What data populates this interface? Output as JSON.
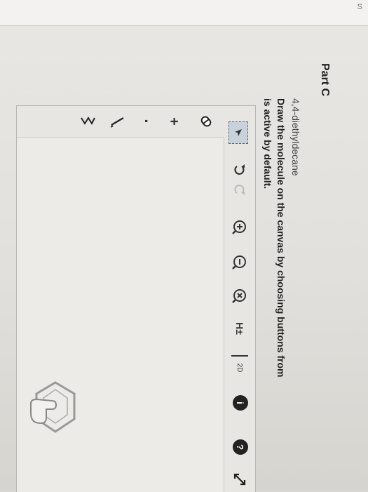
{
  "header": {
    "edge_char": "S"
  },
  "part": {
    "title": "Part C",
    "compound": "4,4-diethyldecane",
    "instruction_line1": "Draw the molecule on the canvas by choosing buttons from",
    "instruction_line2": "is active by default."
  },
  "toolbar": {
    "tools": [
      {
        "name": "select-tool",
        "icon": "marquee-select-icon"
      },
      {
        "name": "undo-button",
        "icon": "undo-icon"
      },
      {
        "name": "redo-button",
        "icon": "redo-icon"
      },
      {
        "name": "zoom-in-button",
        "icon": "zoom-in-icon"
      },
      {
        "name": "zoom-out-button",
        "icon": "zoom-out-icon"
      },
      {
        "name": "clear-button",
        "icon": "clear-icon"
      },
      {
        "name": "hydrogen-button",
        "label": "H±"
      },
      {
        "name": "2d-button",
        "label": "2D"
      },
      {
        "name": "info-button",
        "label": "i"
      },
      {
        "name": "help-button",
        "label": "?"
      },
      {
        "name": "expand-button",
        "icon": "expand-arrows-icon"
      }
    ],
    "left_tools": [
      {
        "name": "eraser-tool",
        "icon": "eraser-icon"
      },
      {
        "name": "charge-plus-tool",
        "label": "+"
      },
      {
        "name": "radical-tool",
        "label": "·"
      },
      {
        "name": "single-bond-tool",
        "icon": "single-bond-icon"
      },
      {
        "name": "chain-tool",
        "icon": "chain-icon"
      }
    ],
    "hydrogen_label": "H±",
    "twod_label": "2D",
    "info_label": "i",
    "help_label": "?",
    "plus_label": "+",
    "dot_label": "·"
  },
  "colors": {
    "background": "#e6e4e0",
    "text": "#222222",
    "selection": "#c7d2dd",
    "dark_button": "#222222"
  }
}
